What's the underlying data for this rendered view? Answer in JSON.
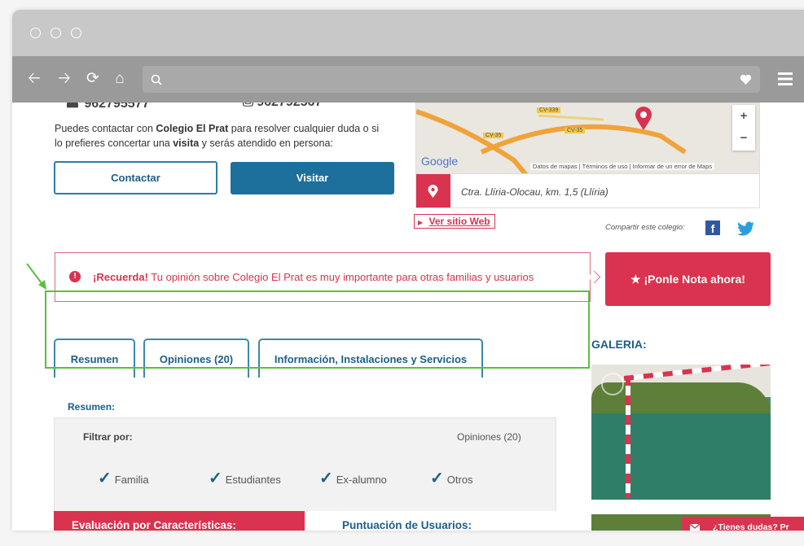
{
  "browser": {
    "title_dots": 3
  },
  "contact": {
    "partial_phone_1": "962795577",
    "partial_phone_2": "962792567",
    "intro_text_1": "Puedes contactar con ",
    "school_name": "Colegio El Prat",
    "intro_text_2": " para resolver cualquier duda o si",
    "intro_text_3": "lo prefieres concertar una ",
    "visit_word": "visita",
    "intro_text_4": " y serás atendido en persona:",
    "contact_button": "Contactar",
    "visit_button": "Visitar"
  },
  "map": {
    "road_label_1": "CV-339",
    "road_label_2": "CV-35",
    "road_label_3": "CV-35",
    "google_logo": "Google",
    "attribution_1": "Datos de mapas",
    "attribution_2": "Términos de uso",
    "attribution_3": "Informar de un error de Maps",
    "zoom_in": "+",
    "zoom_out": "−",
    "address": "Ctra. Llíria-Olocau, km. 1,5 (Llíria)"
  },
  "links": {
    "website": "Ver sitio Web",
    "share_label": "Compartir este colegio:"
  },
  "reminder": {
    "strong": "¡Recuerda!",
    "text": " Tu opinión sobre Colegio El Prat es muy importante para otras familias y usuarios",
    "rate_button": "¡Ponle Nota ahora!"
  },
  "tabs": [
    {
      "label": "Resumen"
    },
    {
      "label": "Opiniones (20)"
    },
    {
      "label": "Información, Instalaciones y Servicios"
    }
  ],
  "gallery": {
    "title": "GALERIA:"
  },
  "summary": {
    "section_title": "Resumen:",
    "filter_label": "Filtrar por:",
    "opinions_count": "Opiniones (20)",
    "filters": [
      {
        "label": "Familia",
        "checked": true
      },
      {
        "label": "Estudiantes",
        "checked": true
      },
      {
        "label": "Ex-alumno",
        "checked": true
      },
      {
        "label": "Otros",
        "checked": true
      }
    ],
    "eval_header": "Evaluación por Características:",
    "users_header": "Puntuación de Usuarios:"
  },
  "chat": {
    "label": "¿Tienes dudas? Pr"
  },
  "colors": {
    "brand_red": "#d9334f",
    "brand_blue": "#1d6f9c",
    "annotation_green": "#5cbf3f"
  }
}
